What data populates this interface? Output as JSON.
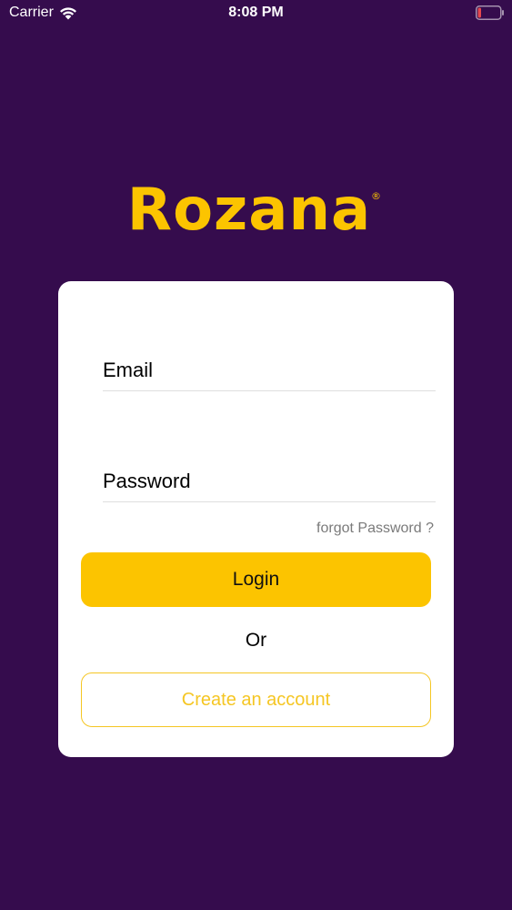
{
  "status_bar": {
    "carrier": "Carrier",
    "time": "8:08 PM",
    "wifi_icon": "wifi-icon",
    "battery_icon": "battery-low-icon",
    "battery_color": "#e5484d"
  },
  "logo": {
    "text": "Rozana",
    "registered_mark": "®",
    "color": "#fcc400"
  },
  "form": {
    "email_placeholder": "Email",
    "email_value": "",
    "password_placeholder": "Password",
    "password_value": "",
    "forgot_label": "forgot Password ?",
    "login_label": "Login",
    "or_label": "Or",
    "create_label": "Create an account"
  },
  "colors": {
    "background": "#350c4d",
    "accent": "#fcc400",
    "card": "#ffffff"
  }
}
